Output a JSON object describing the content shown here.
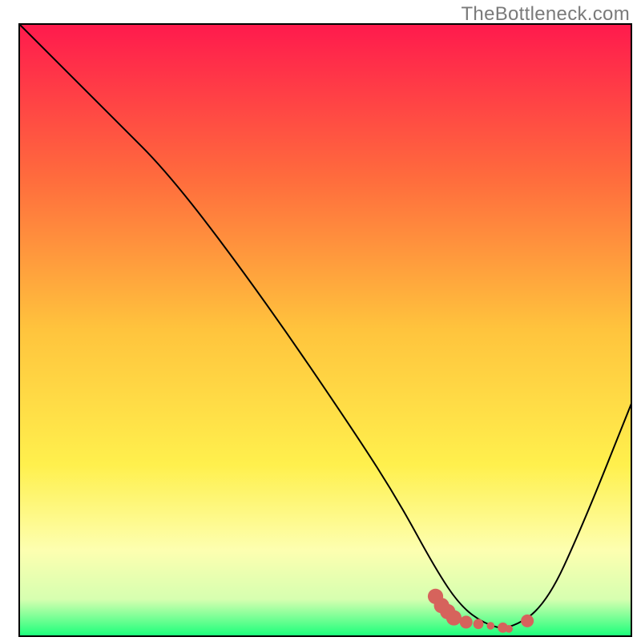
{
  "watermark": "TheBottleneck.com",
  "chart_data": {
    "type": "line",
    "title": "",
    "xlabel": "",
    "ylabel": "",
    "xlim": [
      0,
      100
    ],
    "ylim": [
      0,
      100
    ],
    "grid": false,
    "legend": false,
    "gradient_bg": {
      "stops": [
        {
          "offset": 0,
          "color": "#ff1a4d"
        },
        {
          "offset": 25,
          "color": "#ff6b3d"
        },
        {
          "offset": 50,
          "color": "#ffc43d"
        },
        {
          "offset": 72,
          "color": "#fff04d"
        },
        {
          "offset": 86,
          "color": "#fdffb0"
        },
        {
          "offset": 94,
          "color": "#d6ffb0"
        },
        {
          "offset": 100,
          "color": "#1aff7a"
        }
      ]
    },
    "series": [
      {
        "name": "bottleneck-curve",
        "x": [
          0,
          15,
          25,
          40,
          55,
          62,
          68,
          72,
          76,
          80,
          86,
          92,
          100
        ],
        "y": [
          100,
          85,
          75,
          55,
          33,
          22,
          11,
          5,
          2,
          1,
          5,
          18,
          38
        ]
      }
    ],
    "markers": {
      "name": "highlight-segment",
      "color": "#d6635c",
      "points": [
        {
          "x": 68,
          "y": 6.5,
          "r": 6
        },
        {
          "x": 69,
          "y": 5.0,
          "r": 6
        },
        {
          "x": 70,
          "y": 4.0,
          "r": 6
        },
        {
          "x": 71,
          "y": 3.0,
          "r": 6
        },
        {
          "x": 73,
          "y": 2.3,
          "r": 5
        },
        {
          "x": 75,
          "y": 2.0,
          "r": 4
        },
        {
          "x": 77,
          "y": 1.7,
          "r": 3
        },
        {
          "x": 79,
          "y": 1.4,
          "r": 4
        },
        {
          "x": 80,
          "y": 1.2,
          "r": 3
        },
        {
          "x": 83,
          "y": 2.5,
          "r": 5
        }
      ]
    }
  }
}
